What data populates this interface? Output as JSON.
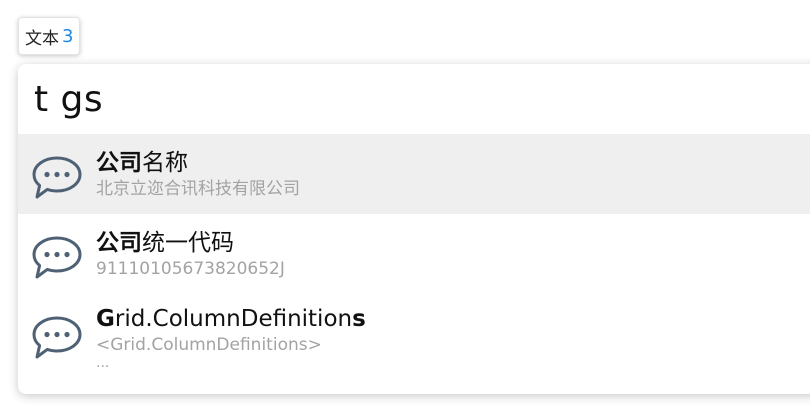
{
  "badge": {
    "label": "文本",
    "count": "3"
  },
  "search": {
    "query": "t gs"
  },
  "results": [
    {
      "title_bold": "公司",
      "title_rest": "名称",
      "subtitle": "北京立迩合讯科技有限公司",
      "icon": "chat-bubble-icon",
      "selected": true
    },
    {
      "title_bold": "公司",
      "title_rest": "统一代码",
      "subtitle": "91110105673820652J",
      "icon": "chat-bubble-icon",
      "selected": false
    },
    {
      "title_bold_start": "G",
      "title_middle": "rid.ColumnDefinition",
      "title_bold_end": "s",
      "subtitle": "<Grid.ColumnDefinitions>",
      "more": "...",
      "icon": "chat-bubble-icon",
      "selected": false
    }
  ],
  "colors": {
    "accent": "#1e88e5",
    "selected_row": "#efefef",
    "icon_stroke": "#4f6275",
    "subtitle": "#a3a3a3"
  }
}
